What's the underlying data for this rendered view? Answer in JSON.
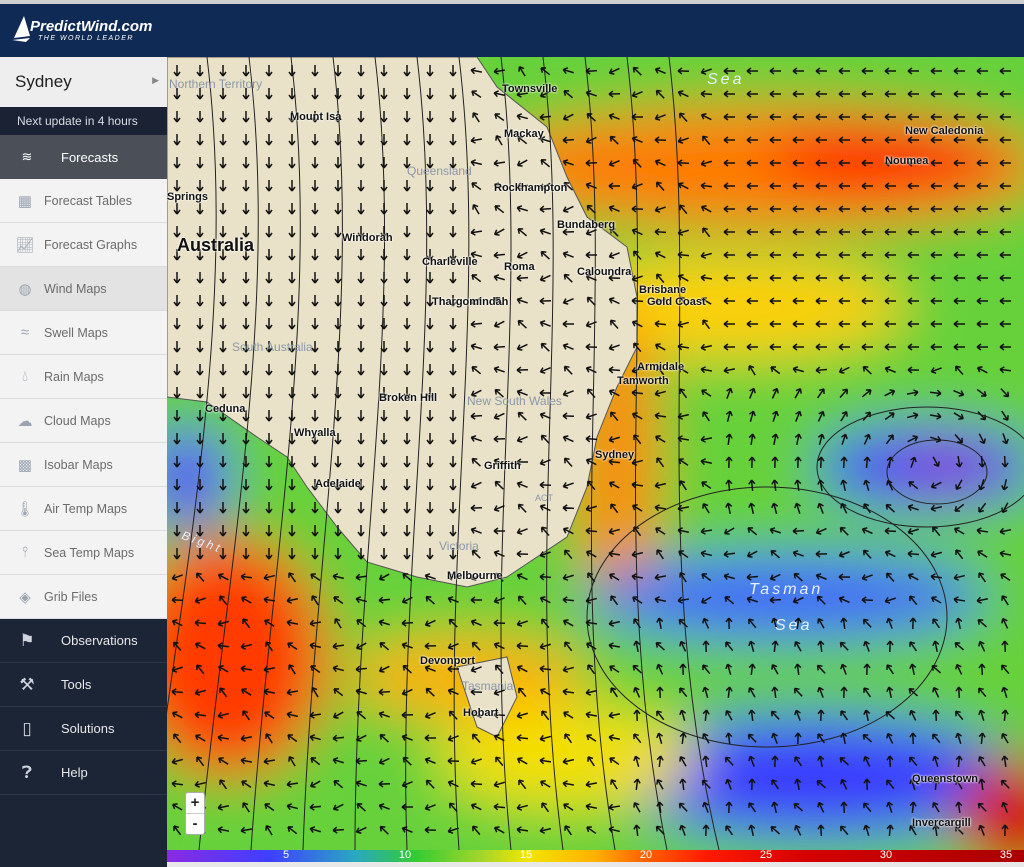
{
  "brand": {
    "name": "PredictWind.com",
    "tagline": "THE WORLD LEADER"
  },
  "sidebar": {
    "location": "Sydney",
    "update": "Next update in 4 hours",
    "section": "Forecasts",
    "items": [
      {
        "label": "Forecast Tables",
        "icon": "table-icon"
      },
      {
        "label": "Forecast Graphs",
        "icon": "graph-icon"
      },
      {
        "label": "Wind Maps",
        "icon": "globe-icon",
        "selected": true
      },
      {
        "label": "Swell Maps",
        "icon": "swell-icon"
      },
      {
        "label": "Rain Maps",
        "icon": "rain-drop-icon"
      },
      {
        "label": "Cloud Maps",
        "icon": "cloud-icon"
      },
      {
        "label": "Isobar Maps",
        "icon": "isobar-icon"
      },
      {
        "label": "Air Temp Maps",
        "icon": "thermometer-icon"
      },
      {
        "label": "Sea Temp Maps",
        "icon": "sea-temp-icon"
      },
      {
        "label": "Grib Files",
        "icon": "grib-icon"
      }
    ],
    "dark_items": [
      {
        "label": "Observations",
        "icon": "flags-icon"
      },
      {
        "label": "Tools",
        "icon": "hammer-icon"
      },
      {
        "label": "Solutions",
        "icon": "phone-icon"
      },
      {
        "label": "Help",
        "icon": "help-bubble-icon"
      }
    ]
  },
  "map": {
    "places": [
      "Townsville",
      "Mackay",
      "Rockhampton",
      "Bundaberg",
      "Mount Isa",
      "Windorah",
      "Charleville",
      "Roma",
      "Caloundra",
      "Brisbane",
      "Gold Coast",
      "Thargomindah",
      "Armidale",
      "Tamworth",
      "Broken Hill",
      "Ceduna",
      "Whyalla",
      "Adelaide",
      "Griffith",
      "Sydney",
      "Melbourne",
      "Devonport",
      "Hobart",
      "New Caledonia",
      "Noumea",
      "Queenstown",
      "Invercargill",
      "Springs"
    ],
    "regions": [
      "Northern Territory",
      "Queensland",
      "South Australia",
      "New South Wales",
      "Victoria",
      "Tasmania",
      "ACT"
    ],
    "country": "Australia",
    "seas": [
      "Tasman",
      "Sea",
      "Sea",
      "Bight"
    ],
    "zoom_in": "+",
    "zoom_out": "-"
  },
  "legend": {
    "unit_ticks": [
      "5",
      "10",
      "15",
      "20",
      "25",
      "30",
      "35"
    ],
    "colors": [
      "#8a2be2",
      "#3f3fff",
      "#33cc33",
      "#f2e600",
      "#ff6a00",
      "#ff1a00",
      "#aa0000"
    ]
  }
}
